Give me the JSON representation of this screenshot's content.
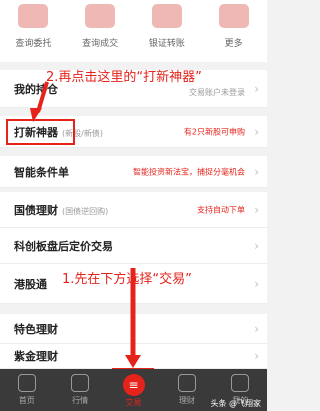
{
  "quick_actions": [
    {
      "label": "查询委托",
      "icon": "query-order-icon"
    },
    {
      "label": "查询成交",
      "icon": "handshake-icon"
    },
    {
      "label": "银证转账",
      "icon": "bank-transfer-icon"
    },
    {
      "label": "更多",
      "icon": "more-icon"
    }
  ],
  "annotation_top": "2.再点击这里的“打新神器”",
  "annotation_bottom": "1.先在下方选择“交易”",
  "rows": {
    "holdings": {
      "title": "我的持仓",
      "right": "交易账户未登录"
    },
    "ipo_tool": {
      "title": "打新神器",
      "sub": "(新股/新债)",
      "right": "有2只新股可申购"
    },
    "smart_order": {
      "title": "智能条件单",
      "right": "智能投资新法宝，捕捉分毫机会"
    },
    "treasury": {
      "title": "国债理财",
      "sub": "(国债逆回购)",
      "right": "支持自动下单"
    },
    "star_market": {
      "title": "科创板盘后定价交易"
    },
    "hk_connect": {
      "title": "港股通"
    },
    "special_wealth": {
      "title": "特色理财"
    },
    "zijin_wealth": {
      "title": "紫金理财"
    }
  },
  "tabs": [
    {
      "label": "首页",
      "icon": "home-icon"
    },
    {
      "label": "行情",
      "icon": "market-icon"
    },
    {
      "label": "交易",
      "icon": "trade-icon"
    },
    {
      "label": "理财",
      "icon": "wealth-icon"
    },
    {
      "label": "我的",
      "icon": "profile-icon"
    }
  ],
  "watermark": "头条 @飞翔家",
  "colors": {
    "accent": "#e5231b",
    "tabbar": "#3a3a3a"
  }
}
